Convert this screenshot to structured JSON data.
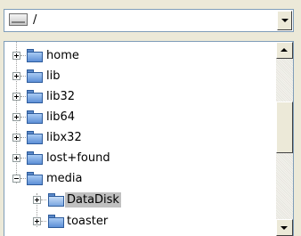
{
  "path_combo": {
    "value": "/",
    "drive_icon": "drive-icon",
    "dropdown_icon": "triangle-down-icon"
  },
  "tree": {
    "items": [
      {
        "label": "home",
        "state": "collapsed",
        "level": 1,
        "icon": "folder-icon"
      },
      {
        "label": "lib",
        "state": "collapsed",
        "level": 1,
        "icon": "folder-icon"
      },
      {
        "label": "lib32",
        "state": "collapsed",
        "level": 1,
        "icon": "folder-icon"
      },
      {
        "label": "lib64",
        "state": "collapsed",
        "level": 1,
        "icon": "folder-icon"
      },
      {
        "label": "libx32",
        "state": "collapsed",
        "level": 1,
        "icon": "folder-icon"
      },
      {
        "label": "lost+found",
        "state": "collapsed",
        "level": 1,
        "icon": "folder-icon"
      },
      {
        "label": "media",
        "state": "expanded",
        "level": 1,
        "icon": "folder-icon"
      },
      {
        "label": "DataDisk",
        "state": "collapsed",
        "level": 2,
        "icon": "folder-open-icon",
        "selected": true
      },
      {
        "label": "toaster",
        "state": "collapsed",
        "level": 2,
        "icon": "folder-icon"
      }
    ]
  },
  "scrollbar": {
    "up_icon": "triangle-up-icon",
    "down_icon": "triangle-down-icon",
    "position": 0.35
  },
  "colors": {
    "selection": "#c0c0c0",
    "window_bg": "#ece9d8",
    "border": "#7f9db9"
  }
}
